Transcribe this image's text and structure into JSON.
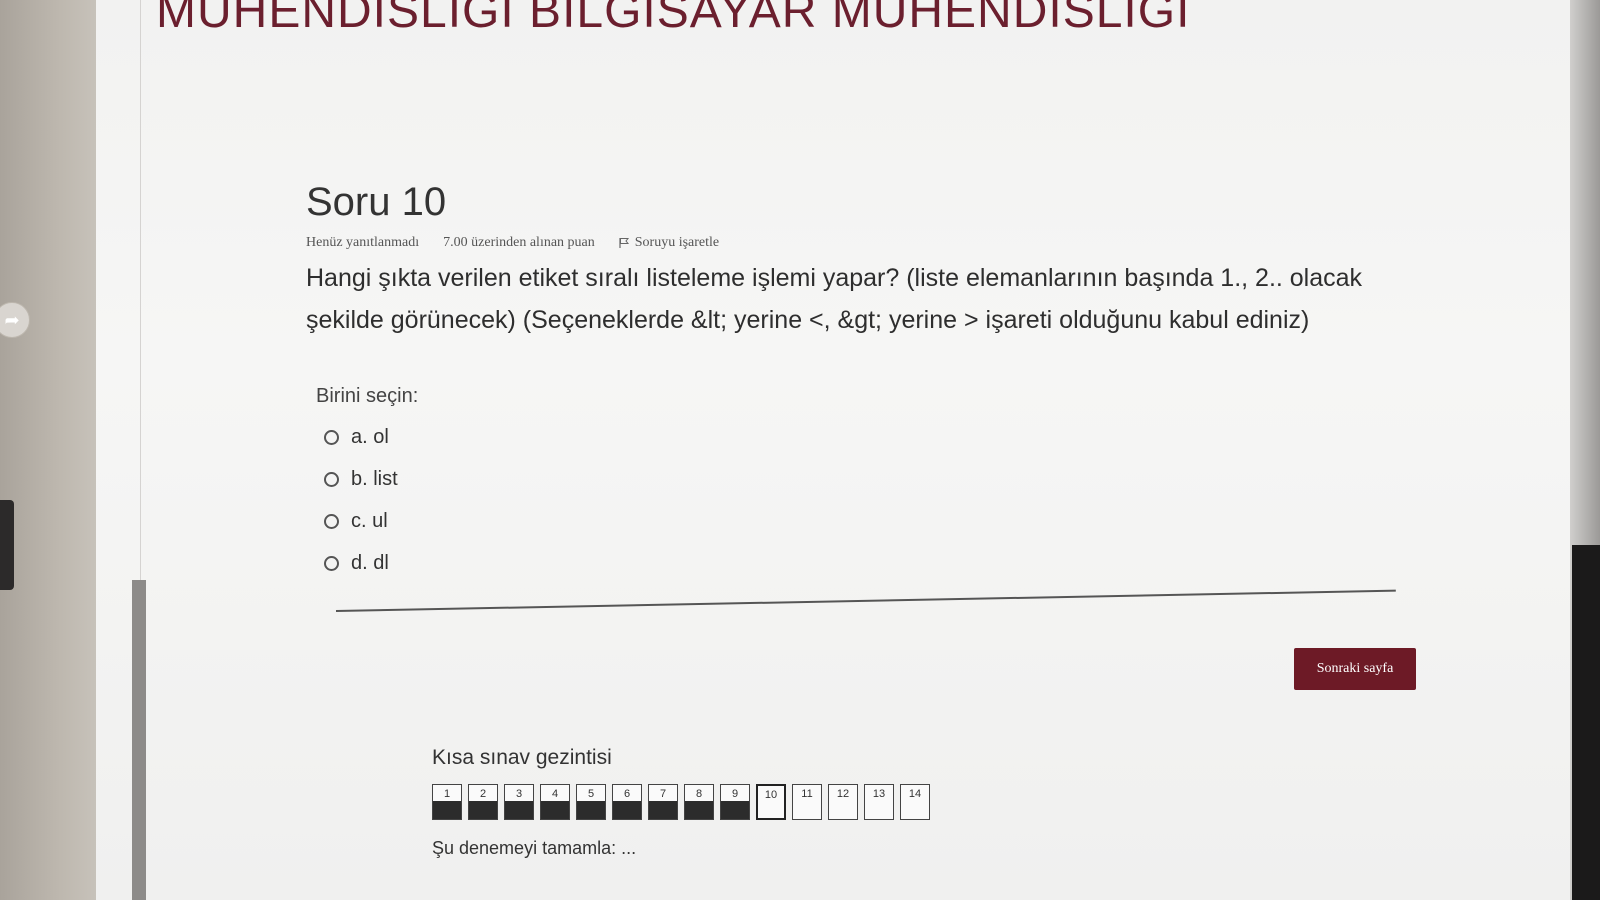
{
  "header": {
    "site_title": "MÜHENDİSLİĞİ BİLGİSAYAR MÜHENDİSLİĞİ"
  },
  "question": {
    "number_label": "Soru 10",
    "status": "Henüz yanıtlanmadı",
    "points": "7.00 üzerinden alınan puan",
    "flag_label": "Soruyu işaretle",
    "text": "Hangi şıkta verilen etiket sıralı listeleme işlemi yapar? (liste elemanlarının başında 1., 2.. olacak şekilde görünecek) (Seçeneklerde &lt; yerine <, &gt; yerine > işareti olduğunu kabul ediniz)",
    "choose_label": "Birini seçin:",
    "options": [
      {
        "label": "a. ol"
      },
      {
        "label": "b. list"
      },
      {
        "label": "c. ul"
      },
      {
        "label": "d. dl"
      }
    ]
  },
  "actions": {
    "next_label": "Sonraki sayfa"
  },
  "quiz_nav": {
    "title": "Kısa sınav gezintisi",
    "buttons": [
      {
        "label": "1",
        "answered": true
      },
      {
        "label": "2",
        "answered": true
      },
      {
        "label": "3",
        "answered": true
      },
      {
        "label": "4",
        "answered": true
      },
      {
        "label": "5",
        "answered": true
      },
      {
        "label": "6",
        "answered": true
      },
      {
        "label": "7",
        "answered": true
      },
      {
        "label": "8",
        "answered": true
      },
      {
        "label": "9",
        "answered": true
      },
      {
        "label": "10",
        "answered": false,
        "current": true
      },
      {
        "label": "11",
        "answered": false
      },
      {
        "label": "12",
        "answered": false
      },
      {
        "label": "13",
        "answered": false
      },
      {
        "label": "14",
        "answered": false
      }
    ],
    "finish_label": "Şu denemeyi tamamla: ..."
  },
  "colors": {
    "brand": "#6d1a26",
    "answered_fill": "#2c2c2c"
  },
  "icons": {
    "flag": "flag-icon",
    "back": "arrow-icon"
  }
}
